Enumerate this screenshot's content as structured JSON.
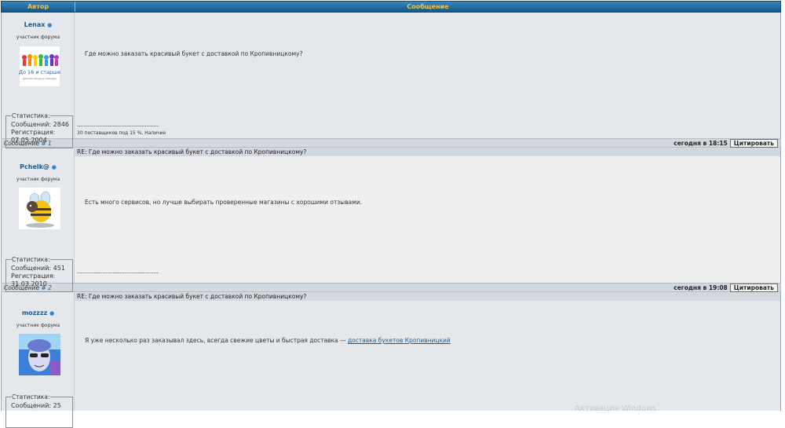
{
  "header": {
    "author": "Автор",
    "message": "Сообщение"
  },
  "posts": [
    {
      "user": "Lenax",
      "rank": "участник форума",
      "stats_legend": "Статистика:",
      "stats_lines": [
        "Сообщений: 2846",
        "Регистрация:",
        "07.05.2004"
      ],
      "text": "Где можно заказать красивый букет с доставкой по Кропивницкому?",
      "sig_line": "------------------------------------------------",
      "sig_text": "30 поставщиков под 15 %, Наличие",
      "footer_label": "Сообщение",
      "footer_link": "# 1",
      "time": "сегодня в 18:15",
      "quote": "Цитировать",
      "avatar_caption": "До 16 и старше",
      "avatar_sub": "детские интернет-магазин"
    },
    {
      "subject": "RE: Где можно заказать красивый букет с доставкой по Кропивницкому?",
      "user": "Pchelk@",
      "rank": "участник форума",
      "stats_legend": "Статистика:",
      "stats_lines": [
        "Сообщений: 451",
        "Регистрация:",
        "31.03.2010"
      ],
      "text": "Есть много сервисов, но лучше выбирать проверенные магазины с хорошими отзывами.",
      "sig_line": "------------------------------------------------",
      "footer_label": "Сообщение",
      "footer_link": "# 2",
      "time": "сегодня в 19:08",
      "quote": "Цитировать"
    },
    {
      "subject": "RE: Где можно заказать красивый букет с доставкой по Кропивницкому?",
      "user": "mozzzz",
      "rank": "участник форума",
      "stats_legend": "Статистика:",
      "stats_lines": [
        "Сообщений: 25"
      ],
      "text": "Я уже несколько раз заказывал здесь, всегда свежие цветы и быстрая доставка — ",
      "link": "доставка букетов Кропивницкий"
    }
  ],
  "watermark": "Активация Windows",
  "colors": {
    "header_bg": "#1a6494",
    "header_text": "#f5c04a",
    "author_bg": "#e4e8ec",
    "bar_bg": "#d3d8de",
    "link": "#1a5b8a"
  }
}
